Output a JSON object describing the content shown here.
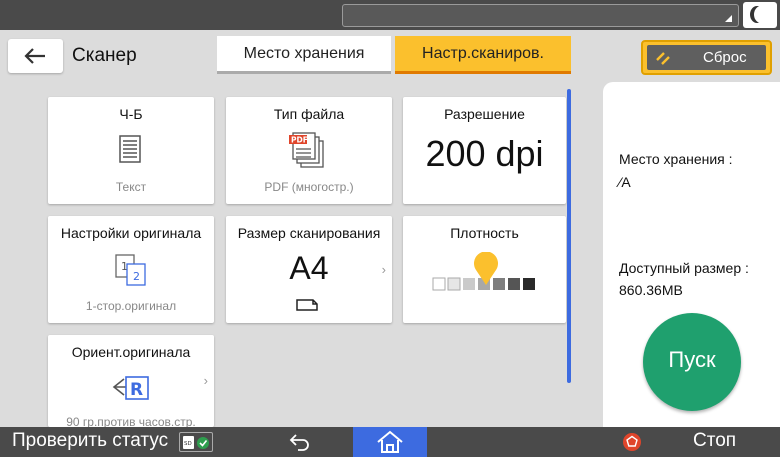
{
  "header": {
    "title": "Сканер",
    "tabs": [
      {
        "label": "Место хранения",
        "active": false
      },
      {
        "label": "Настр.сканиров.",
        "active": true
      }
    ],
    "reset_label": "Сброс"
  },
  "tiles": {
    "color_mode": {
      "title": "Ч-Б",
      "value": "Текст"
    },
    "file_type": {
      "title": "Тип файла",
      "value": "PDF (многостр.)",
      "icon_text": "PDF"
    },
    "resolution": {
      "title": "Разрешение",
      "value": "200 dpi"
    },
    "original_settings": {
      "title": "Настройки оригинала",
      "value": "1-стор.оригинал",
      "icon_num_1": "1",
      "icon_num_2": "2"
    },
    "scan_size": {
      "title": "Размер сканирования",
      "value": "A4"
    },
    "density": {
      "title": "Плотность",
      "level": 4,
      "steps": 7
    },
    "orientation": {
      "title": "Ориент.оригинала",
      "value": "90 гр.против часов.стр.",
      "icon_letter": "R"
    }
  },
  "right_panel": {
    "storage_label": "Место хранения :",
    "storage_value": "⁄A",
    "available_label": "Доступный размер :",
    "available_value": "860.36MB",
    "start_label": "Пуск"
  },
  "bottom_bar": {
    "status_label": "Проверить статус",
    "sd_label": "SD",
    "stop_label": "Стоп"
  },
  "colors": {
    "accent_yellow": "#fbc02d",
    "tab_underline": "#e07a00",
    "start_green": "#1fa06e",
    "home_blue": "#3d6be0",
    "stop_red": "#e0452b"
  }
}
